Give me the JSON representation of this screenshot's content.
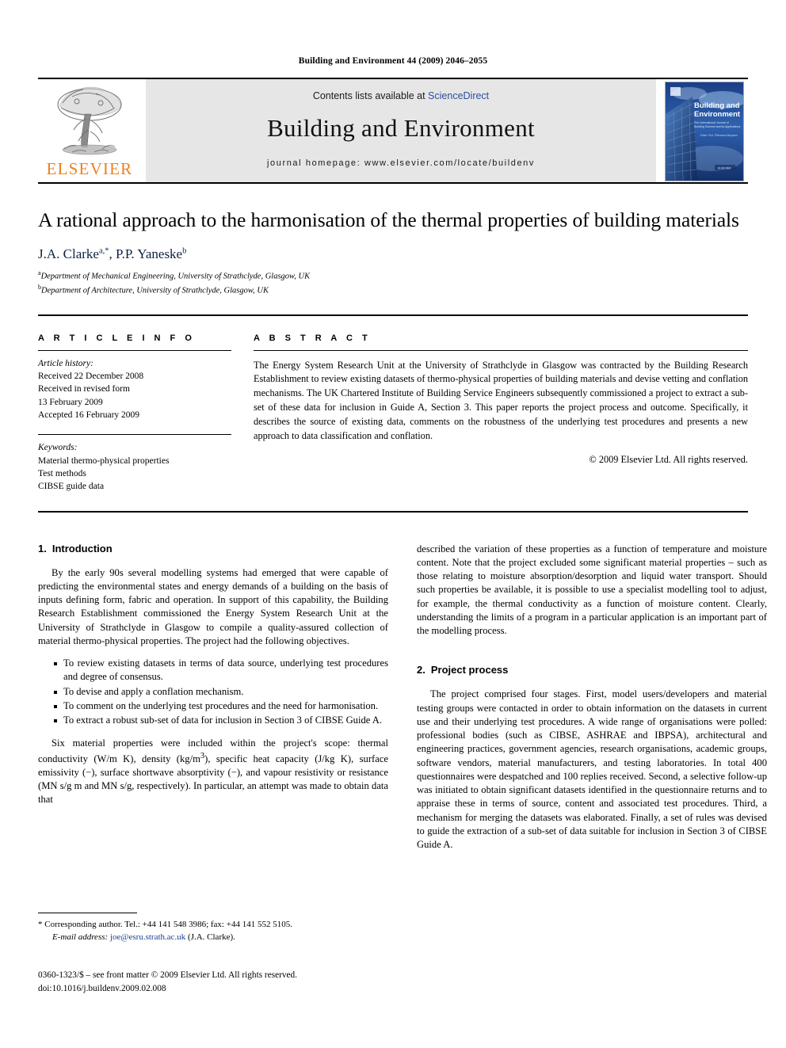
{
  "running_head": "Building and Environment 44 (2009) 2046–2055",
  "masthead": {
    "publisher_name": "ELSEVIER",
    "contents_prefix": "Contents lists available at ",
    "contents_link": "ScienceDirect",
    "journal_title": "Building and Environment",
    "homepage_label": "journal homepage: www.elsevier.com/locate/buildenv",
    "cover_title_line1": "Building and",
    "cover_title_line2": "Environment",
    "cover_subtitle": "The International Journal of Building Science and its Applications"
  },
  "article": {
    "title": "A rational approach to the harmonisation of the thermal properties of building materials",
    "authors": "J.A. Clarke",
    "author_sup_1": "a,*",
    "author_second": ", P.P. Yaneske",
    "author_sup_2": "b",
    "affiliation_a_sup": "a",
    "affiliation_a": "Department of Mechanical Engineering, University of Strathclyde, Glasgow, UK",
    "affiliation_b_sup": "b",
    "affiliation_b": "Department of Architecture, University of Strathclyde, Glasgow, UK"
  },
  "article_info": {
    "heading": "A R T I C L E   I N F O",
    "history_label": "Article history:",
    "history_lines": [
      "Received 22 December 2008",
      "Received in revised form",
      "13 February 2009",
      "Accepted 16 February 2009"
    ],
    "keywords_label": "Keywords:",
    "keywords": [
      "Material thermo-physical properties",
      "Test methods",
      "CIBSE guide data"
    ]
  },
  "abstract": {
    "heading": "A B S T R A C T",
    "text": "The Energy System Research Unit at the University of Strathclyde in Glasgow was contracted by the Building Research Establishment to review existing datasets of thermo-physical properties of building materials and devise vetting and conflation mechanisms. The UK Chartered Institute of Building Service Engineers subsequently commissioned a project to extract a sub-set of these data for inclusion in Guide A, Section 3. This paper reports the project process and outcome. Specifically, it describes the source of existing data, comments on the robustness of the underlying test procedures and presents a new approach to data classification and conflation.",
    "copyright": "© 2009 Elsevier Ltd. All rights reserved."
  },
  "sections": {
    "introduction": {
      "number": "1.",
      "title": "Introduction",
      "para1": "By the early 90s several modelling systems had emerged that were capable of predicting the environmental states and energy demands of a building on the basis of inputs defining form, fabric and operation. In support of this capability, the Building Research Establishment commissioned the Energy System Research Unit at the University of Strathclyde in Glasgow to compile a quality-assured collection of material thermo-physical properties. The project had the following objectives.",
      "objectives": [
        "To review existing datasets in terms of data source, underlying test procedures and degree of consensus.",
        "To devise and apply a conflation mechanism.",
        "To comment on the underlying test procedures and the need for harmonisation.",
        "To extract a robust sub-set of data for inclusion in Section 3 of CIBSE Guide A."
      ],
      "para2_a": "Six material properties were included within the project's scope: thermal conductivity (W/m K), density (kg/m",
      "para2_sup": "3",
      "para2_b": "), specific heat capacity (J/kg K), surface emissivity (−), surface shortwave absorptivity (−), and vapour resistivity or resistance (MN s/g m and MN s/g, respectively). In particular, an attempt was made to obtain data that",
      "para3": "described the variation of these properties as a function of temperature and moisture content. Note that the project excluded some significant material properties – such as those relating to moisture absorption/desorption and liquid water transport. Should such properties be available, it is possible to use a specialist modelling tool to adjust, for example, the thermal conductivity as a function of moisture content. Clearly, understanding the limits of a program in a particular application is an important part of the modelling process."
    },
    "project_process": {
      "number": "2.",
      "title": "Project process",
      "para1": "The project comprised four stages. First, model users/developers and material testing groups were contacted in order to obtain information on the datasets in current use and their underlying test procedures. A wide range of organisations were polled: professional bodies (such as CIBSE, ASHRAE and IBPSA), architectural and engineering practices, government agencies, research organisations, academic groups, software vendors, material manufacturers, and testing laboratories. In total 400 questionnaires were despatched and 100 replies received. Second, a selective follow-up was initiated to obtain significant datasets identified in the questionnaire returns and to appraise these in terms of source, content and associated test procedures. Third, a mechanism for merging the datasets was elaborated. Finally, a set of rules was devised to guide the extraction of a sub-set of data suitable for inclusion in Section 3 of CIBSE Guide A."
    }
  },
  "footnotes": {
    "corresponding_marker": "*",
    "corresponding_text": "Corresponding author. Tel.: +44 141 548 3986; fax: +44 141 552 5105.",
    "email_label": "E-mail address:",
    "email": "joe@esru.strath.ac.uk",
    "email_suffix": "(J.A. Clarke)."
  },
  "imprint": {
    "line1": "0360-1323/$ – see front matter © 2009 Elsevier Ltd. All rights reserved.",
    "line2": "doi:10.1016/j.buildenv.2009.02.008"
  },
  "colors": {
    "elsevier_orange": "#F07F1A",
    "link_blue": "#2b4d9e",
    "author_navy": "#0d2240",
    "banner_gray": "#e6e6e6"
  }
}
